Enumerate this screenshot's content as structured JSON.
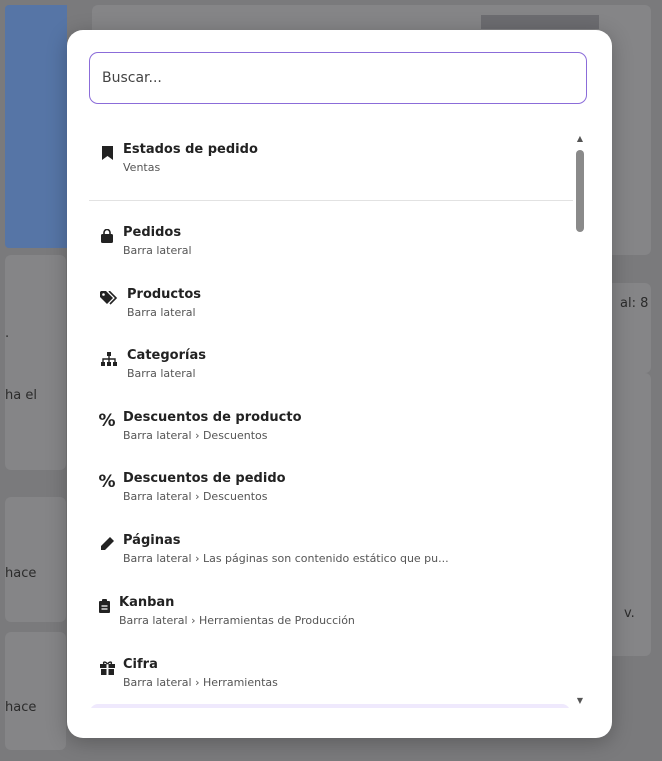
{
  "background": {
    "fragments": [
      ".",
      "ha el",
      "hace",
      "hace",
      "al: 8",
      "v."
    ]
  },
  "search": {
    "placeholder": "Buscar..."
  },
  "results": [
    {
      "icon": "bookmark-icon",
      "title": "Estados de pedido",
      "subtitle": "Ventas"
    },
    {
      "icon": "shopping-bag-icon",
      "title": "Pedidos",
      "subtitle": "Barra lateral"
    },
    {
      "icon": "tags-icon",
      "title": "Productos",
      "subtitle": "Barra lateral"
    },
    {
      "icon": "sitemap-icon",
      "title": "Categorías",
      "subtitle": "Barra lateral"
    },
    {
      "icon": "percent-icon",
      "title": "Descuentos de producto",
      "subtitle": "Barra lateral › Descuentos"
    },
    {
      "icon": "percent-icon",
      "title": "Descuentos de pedido",
      "subtitle": "Barra lateral › Descuentos"
    },
    {
      "icon": "pencil-icon",
      "title": "Páginas",
      "subtitle": "Barra lateral › Las páginas son contenido estático que pu..."
    },
    {
      "icon": "clipboard-icon",
      "title": "Kanban",
      "subtitle": "Barra lateral › Herramientas de Producción"
    },
    {
      "icon": "gift-icon",
      "title": "Cifra",
      "subtitle": "Barra lateral › Herramientas"
    }
  ],
  "colors": {
    "accent": "#8b6cd9",
    "highlight": "#efe9fd",
    "overlay": "#7a7a7c",
    "blue": "#5675a6"
  }
}
